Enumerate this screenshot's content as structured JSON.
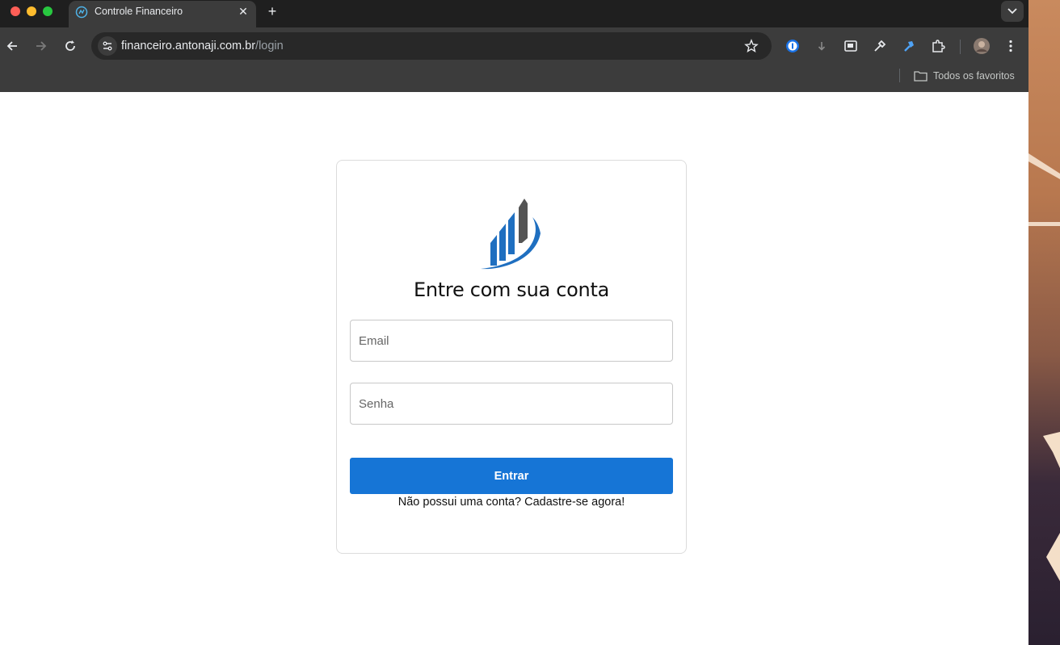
{
  "browser": {
    "tab_title": "Controle Financeiro",
    "url_host": "financeiro.antonaji.com.br",
    "url_path": "/login",
    "bookmarks_label": "Todos os favoritos"
  },
  "login": {
    "heading": "Entre com sua conta",
    "email_placeholder": "Email",
    "password_placeholder": "Senha",
    "submit_label": "Entrar",
    "signup_text": "Não possui uma conta? Cadastre-se agora!"
  },
  "colors": {
    "primary_button": "#1675d6",
    "logo_blue": "#1f6fc0",
    "logo_gray": "#555555"
  }
}
